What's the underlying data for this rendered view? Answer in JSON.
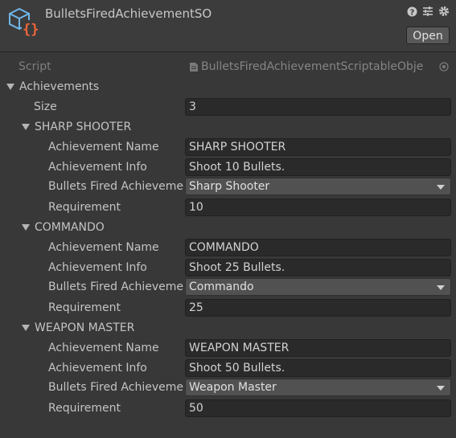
{
  "header": {
    "title": "BulletsFiredAchievementSO",
    "open_label": "Open",
    "icons": [
      "help-icon",
      "settings-sliders-icon",
      "gear-icon"
    ],
    "accent_colors": {
      "cube": "#6fb6e8",
      "braces": "#f0653a"
    }
  },
  "script_field": {
    "label": "Script",
    "value": "BulletsFiredAchievementScriptableObje"
  },
  "achievements": {
    "label": "Achievements",
    "size_label": "Size",
    "size_value": "3",
    "items": [
      {
        "header": "SHARP SHOOTER",
        "name_label": "Achievement Name",
        "name_value": "SHARP SHOOTER",
        "info_label": "Achievement Info",
        "info_value": "Shoot 10 Bullets.",
        "type_label": "Bullets Fired Achieveme",
        "type_value": "Sharp Shooter",
        "req_label": "Requirement",
        "req_value": "10"
      },
      {
        "header": "COMMANDO",
        "name_label": "Achievement Name",
        "name_value": "COMMANDO",
        "info_label": "Achievement Info",
        "info_value": "Shoot 25 Bullets.",
        "type_label": "Bullets Fired Achieveme",
        "type_value": "Commando",
        "req_label": "Requirement",
        "req_value": "25"
      },
      {
        "header": "WEAPON MASTER",
        "name_label": "Achievement Name",
        "name_value": "WEAPON MASTER",
        "info_label": "Achievement Info",
        "info_value": "Shoot 50 Bullets.",
        "type_label": "Bullets Fired Achieveme",
        "type_value": "Weapon Master",
        "req_label": "Requirement",
        "req_value": "50"
      }
    ]
  }
}
